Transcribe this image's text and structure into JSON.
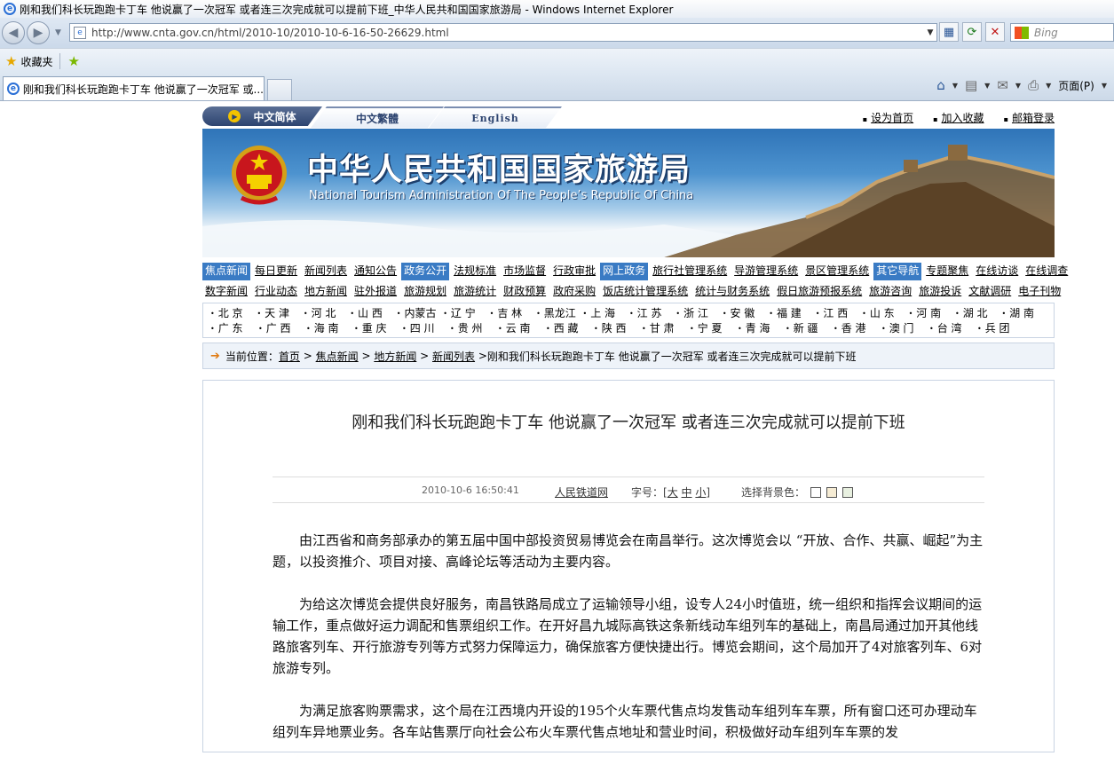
{
  "browser": {
    "window_title": "刚和我们科长玩跑跑卡丁车 他说赢了一次冠军 或者连三次完成就可以提前下班_中华人民共和国国家旅游局 - Windows Internet Explorer",
    "url": "http://www.cnta.gov.cn/html/2010-10/2010-10-6-16-50-26629.html",
    "search_placeholder": "Bing",
    "favorites_label": "收藏夹",
    "tab_title": "刚和我们科长玩跑跑卡丁车 他说赢了一次冠军 或...",
    "page_menu": "页面(P)"
  },
  "site": {
    "lang": [
      "中文简体",
      "中文繁體",
      "English"
    ],
    "toplinks": [
      "设为首页",
      "加入收藏",
      "邮箱登录"
    ],
    "title_cn": "中华人民共和国国家旅游局",
    "title_en": "National Tourism Administration Of The People’s Republic Of China"
  },
  "menu_row1": [
    {
      "label": "焦点新闻",
      "hl": true
    },
    {
      "label": "每日更新"
    },
    {
      "label": "新闻列表"
    },
    {
      "label": "通知公告"
    },
    {
      "label": "政务公开",
      "hl": true
    },
    {
      "label": "法规标准"
    },
    {
      "label": "市场监督"
    },
    {
      "label": "行政审批"
    },
    {
      "label": "网上政务",
      "hl": true
    },
    {
      "label": "旅行社管理系统"
    },
    {
      "label": "导游管理系统"
    },
    {
      "label": "景区管理系统"
    },
    {
      "label": "其它导航",
      "hl": true
    },
    {
      "label": "专题聚焦"
    },
    {
      "label": "在线访谈"
    },
    {
      "label": "在线调查"
    }
  ],
  "menu_row2": [
    "数字新闻",
    "行业动态",
    "地方新闻",
    "驻外报道",
    "旅游规划",
    "旅游统计",
    "财政预算",
    "政府采购",
    "饭店统计管理系统",
    "统计与财务系统",
    "假日旅游预报系统",
    "旅游咨询",
    "旅游投诉",
    "文献调研",
    "电子刊物"
  ],
  "regions": {
    "row1": [
      "北 京",
      "天 津",
      "河 北",
      "山 西",
      "内蒙古",
      "辽 宁",
      "吉 林",
      "黑龙江",
      "上 海",
      "江 苏",
      "浙 江",
      "安 徽",
      "福 建",
      "江 西",
      "山 东",
      "河 南",
      "湖 北",
      "湖 南"
    ],
    "row2": [
      "广 东",
      "广 西",
      "海 南",
      "重 庆",
      "四 川",
      "贵 州",
      "云 南",
      "西 藏",
      "陕 西",
      "甘 肃",
      "宁 夏",
      "青 海",
      "新 疆",
      "香 港",
      "澳 门",
      "台 湾",
      "兵 团"
    ]
  },
  "breadcrumb": {
    "prefix": "当前位置：",
    "links": [
      "首页",
      "焦点新闻",
      "地方新闻",
      "新闻列表"
    ],
    "current": "刚和我们科长玩跑跑卡丁车 他说赢了一次冠军 或者连三次完成就可以提前下班"
  },
  "article": {
    "title": "刚和我们科长玩跑跑卡丁车 他说赢了一次冠军 或者连三次完成就可以提前下班",
    "date": "2010-10-6 16:50:41",
    "source": "人民铁道网",
    "font_label": "字号：",
    "font_sizes": [
      "大",
      "中",
      "小"
    ],
    "bg_label": "选择背景色：",
    "bg_colors": [
      "#ffffff",
      "#f6ecd4",
      "#e8f0e0"
    ],
    "paragraphs": [
      "由江西省和商务部承办的第五届中国中部投资贸易博览会在南昌举行。这次博览会以 “开放、合作、共赢、崛起”为主题，以投资推介、项目对接、高峰论坛等活动为主要内容。",
      "为给这次博览会提供良好服务，南昌铁路局成立了运输领导小组，设专人24小时值班，统一组织和指挥会议期间的运输工作，重点做好运力调配和售票组织工作。在开好昌九城际高铁这条新线动车组列车的基础上，南昌局通过加开其他线路旅客列车、开行旅游专列等方式努力保障运力，确保旅客方便快捷出行。博览会期间，这个局加开了4对旅客列车、6对旅游专列。",
      "为满足旅客购票需求，这个局在江西境内开设的195个火车票代售点均发售动车组列车车票，所有窗口还可办理动车组列车异地票业务。各车站售票厅向社会公布火车票代售点地址和营业时间，积极做好动车组列车车票的发"
    ]
  }
}
